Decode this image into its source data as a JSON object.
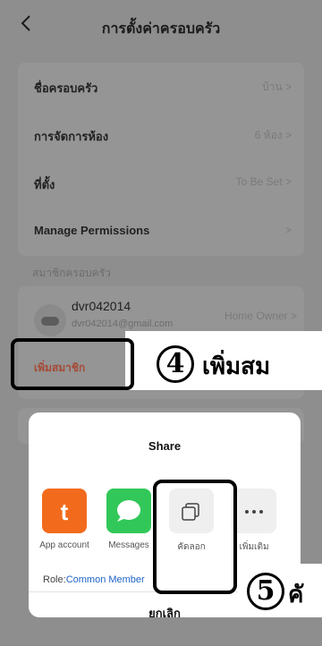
{
  "header": {
    "title": "การตั้งค่าครอบครัว",
    "back_icon": "chevron-left-icon"
  },
  "settings": [
    {
      "label": "ชื่อครอบครัว",
      "value": "บ้าน >"
    },
    {
      "label": "การจัดการห้อง",
      "value": "6 ห้อง >"
    },
    {
      "label": "ที่ตั้ง",
      "value": "To Be Set >"
    },
    {
      "label": "Manage Permissions",
      "value": ">"
    }
  ],
  "members_section": "สมาชิกครอบครัว",
  "member": {
    "name": "dvr042014",
    "email": "dvr042014@gmail.com",
    "role": "Home Owner >"
  },
  "add_member": "เพิ่มสมาชิก",
  "annotation4": {
    "number": "4",
    "text": "เพิ่มสม"
  },
  "annotation5": {
    "number": "5",
    "text": "คั"
  },
  "share": {
    "title": "Share",
    "options": [
      {
        "label": "App account",
        "icon": "tuya-icon",
        "color": "#f26b1d"
      },
      {
        "label": "Messages",
        "icon": "message-bubble-icon",
        "color": "#32c859"
      },
      {
        "label": "คัดลอก",
        "icon": "copy-icon",
        "color": "#efefef"
      },
      {
        "label": "เพิ่มเติม",
        "icon": "more-dots-icon",
        "color": "#efefef"
      }
    ],
    "role_label": "Role:",
    "role_value": "Common Member",
    "cancel": "ยกเลิก"
  }
}
